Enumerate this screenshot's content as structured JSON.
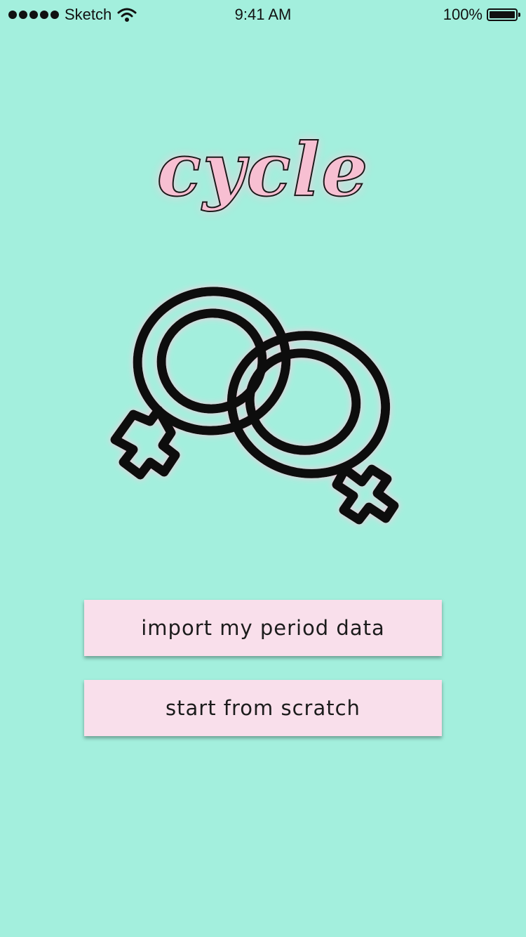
{
  "status_bar": {
    "carrier": "Sketch",
    "time": "9:41 AM",
    "battery": "100%",
    "signal_icon": "signal-dots-icon",
    "wifi_icon": "wifi-icon",
    "battery_icon": "battery-icon"
  },
  "app": {
    "logo_text": "cycle",
    "hero_icon": "interlocked-female-symbols-icon"
  },
  "actions": {
    "import_label": "import my period data",
    "scratch_label": "start from scratch"
  },
  "colors": {
    "background": "#a3efdd",
    "button_fill": "#f9dfeb",
    "logo_fill": "#f7bfd2",
    "icon_stroke": "#111111",
    "glow": "#ffc8dc"
  }
}
